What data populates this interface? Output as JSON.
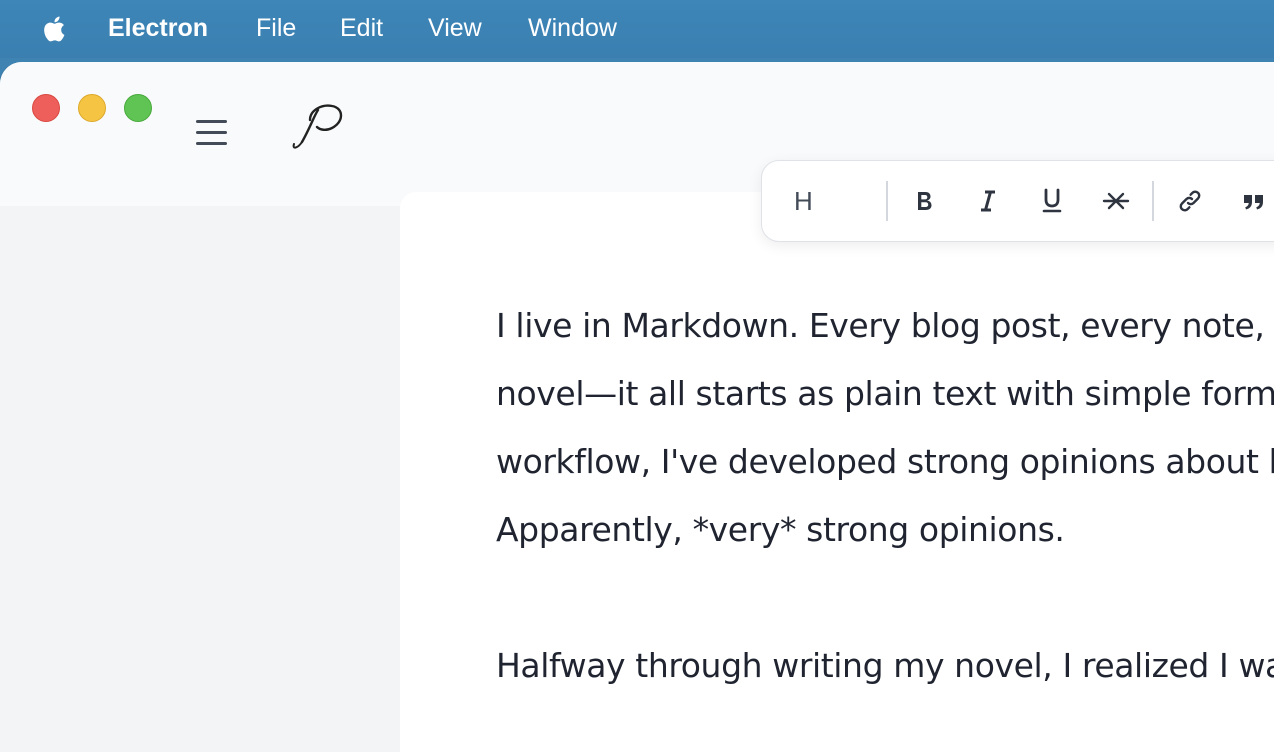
{
  "menubar": {
    "app_name": "Electron",
    "items": [
      "File",
      "Edit",
      "View",
      "Window"
    ]
  },
  "toolbar": {
    "heading_label": "H"
  },
  "editor": {
    "paragraphs": [
      [
        "I live in Markdown. Every blog post, every note, e",
        "novel—it all starts as plain text with simple forma",
        "workflow, I've developed strong opinions about h",
        "Apparently, *very* strong opinions."
      ],
      [
        "Halfway through writing my novel, I realized I was"
      ]
    ]
  },
  "colors": {
    "menubar": "#3f83b3",
    "traffic_close": "#ee5f5b",
    "traffic_minimize": "#f6c443",
    "traffic_maximize": "#5fc454"
  }
}
